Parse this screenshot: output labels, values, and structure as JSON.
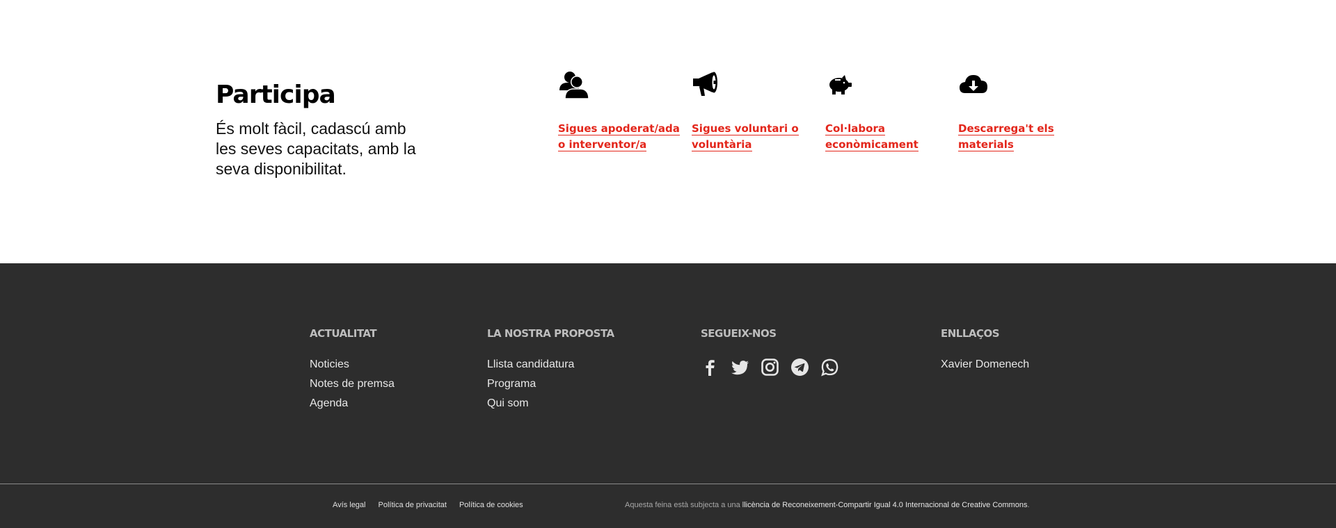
{
  "participa": {
    "title": "Participa",
    "text": "És molt fàcil, cadascú amb les seves capacitats, amb la seva disponibilitat.",
    "actions": [
      {
        "label": "Sigues apoderat/ada o interventor/a",
        "icon": "users-icon"
      },
      {
        "label": "Sigues voluntari o voluntària",
        "icon": "megaphone-icon"
      },
      {
        "label": "Col·labora econòmicament",
        "icon": "piggy-bank-icon"
      },
      {
        "label": "Descarrega't els materials",
        "icon": "cloud-download-icon"
      }
    ],
    "link_color": "#e3261b"
  },
  "footer": {
    "background": "#2d2d2d",
    "actualitat": {
      "title": "ACTUALITAT",
      "items": [
        "Noticies",
        "Notes de premsa",
        "Agenda"
      ]
    },
    "proposta": {
      "title": "LA NOSTRA PROPOSTA",
      "items": [
        "Llista candidatura",
        "Programa",
        "Qui som"
      ]
    },
    "segueix": {
      "title": "SEGUEIX-NOS",
      "icons": [
        "facebook-icon",
        "twitter-icon",
        "instagram-icon",
        "telegram-icon",
        "whatsapp-icon"
      ]
    },
    "enllacos": {
      "title": "ENLLAÇOS",
      "items": [
        "Xavier Domenech"
      ]
    },
    "bottom_links": [
      "Avís legal",
      "Política de privacitat",
      "Política de cookies"
    ],
    "license_prefix": "Aquesta feina està subjecta a una",
    "license_link": "llicència de Reconeixement-Compartir Igual 4.0 Internacional de Creative Commons",
    "license_suffix": "."
  }
}
